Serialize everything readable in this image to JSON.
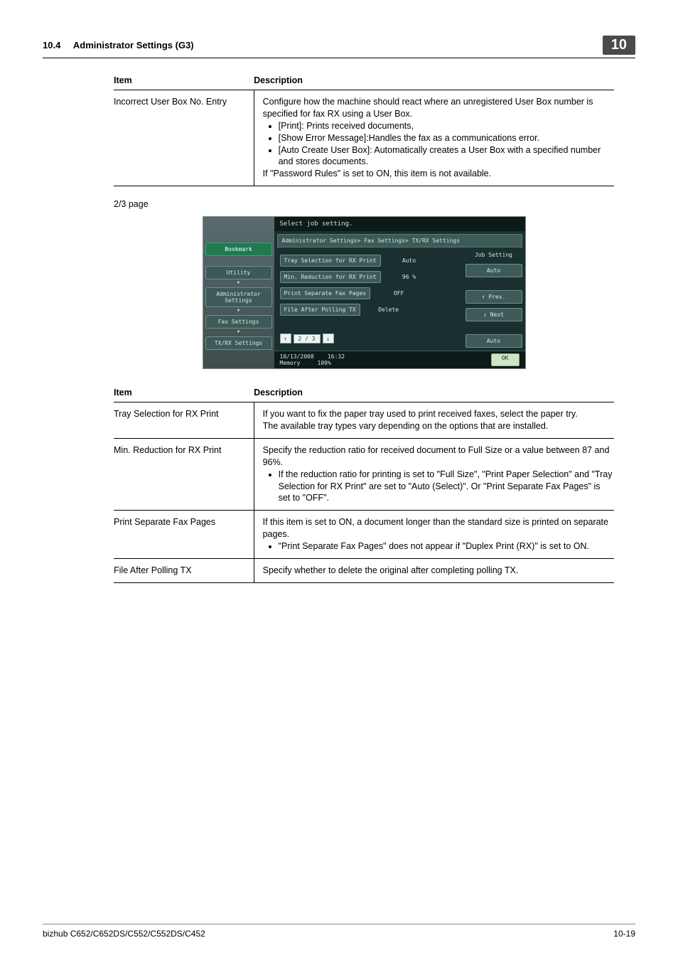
{
  "header": {
    "section": "10.4",
    "title": "Administrator Settings (G3)",
    "badge": "10"
  },
  "table1": {
    "col_item": "Item",
    "col_desc": "Description",
    "rows": [
      {
        "item": "Incorrect User Box No. Entry",
        "desc_intro": "Configure how the machine should react where an unregistered User Box number is specified for fax RX using a User Box.",
        "bullets": [
          "[Print]: Prints received documents,",
          "[Show Error Message]:Handles the fax as a communications error.",
          "[Auto Create User Box]: Automatically creates a User Box with a specified number and stores documents."
        ],
        "desc_outro": "If \"Password Rules\" is set to ON, this item is not available."
      }
    ]
  },
  "page_label": "2/3 page",
  "screenshot": {
    "title": "Select job setting.",
    "breadcrumb": "Administrator Settings> Fax Settings> TX/RX Settings",
    "left_nav": {
      "bookmark": "Bookmark",
      "utility": "Utility",
      "admin": "Administrator Settings",
      "fax": "Fax Settings",
      "txrx": "TX/RX Settings"
    },
    "rows": [
      {
        "label": "Tray Selection for RX Print",
        "value": "Auto"
      },
      {
        "label": "Min. Reduction for RX Print",
        "value": "96 %"
      },
      {
        "label": "Print Separate Fax Pages",
        "value": "OFF"
      },
      {
        "label": "File After Polling TX",
        "value": "Delete"
      }
    ],
    "pager": {
      "up": "↑",
      "page": "2 / 3",
      "down": "↓"
    },
    "side": {
      "heading": "Job Setting",
      "auto_top": "Auto",
      "prev": "↑ Prev.",
      "next": "↓ Next",
      "auto_bottom": "Auto"
    },
    "status": {
      "date": "10/13/2008",
      "time": "16:32",
      "memory_label": "Memory",
      "memory_value": "100%",
      "ok": "OK"
    }
  },
  "table2": {
    "col_item": "Item",
    "col_desc": "Description",
    "rows": [
      {
        "item": "Tray Selection for RX Print",
        "desc_intro": "If you want to fix the paper tray used to print received faxes, select the paper try.",
        "desc_outro": "The available tray types vary depending on the options that are installed."
      },
      {
        "item": "Min. Reduction for RX Print",
        "desc_intro": "Specify the reduction ratio for received document to Full Size or a value between 87 and 96%.",
        "bullets": [
          "If the reduction ratio for printing is set to \"Full Size\", \"Print Paper Selection\" and \"Tray Selection for RX Print\" are set to \"Auto (Select)\". Or \"Print Separate Fax Pages\" is set to \"OFF\"."
        ]
      },
      {
        "item": "Print Separate Fax Pages",
        "desc_intro": "If this item is set to ON, a document longer than the standard size is printed on separate pages.",
        "bullets": [
          "\"Print Separate Fax Pages\" does not appear if \"Duplex Print (RX)\" is set to ON."
        ]
      },
      {
        "item": "File After Polling TX",
        "desc_intro": "Specify whether to delete the original after completing polling TX."
      }
    ]
  },
  "footer": {
    "model": "bizhub C652/C652DS/C552/C552DS/C452",
    "page": "10-19"
  }
}
